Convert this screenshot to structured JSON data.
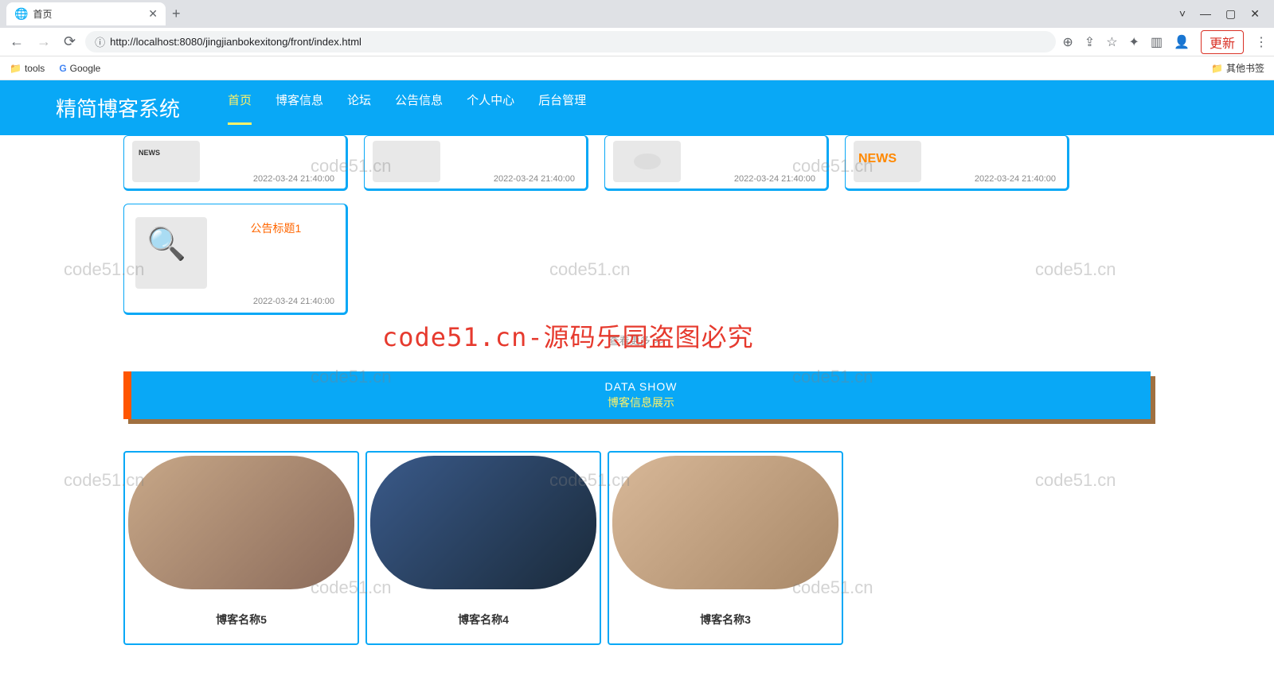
{
  "browser": {
    "tab_title": "首页",
    "new_tab": "+",
    "win": {
      "min": "—",
      "max": "▢",
      "close": "✕",
      "chevron": "˅"
    },
    "back": "←",
    "forward": "→",
    "reload": "⟳",
    "info_icon": "ⓘ",
    "url": "http://localhost:8080/jingjianbokexitong/front/index.html",
    "addr_icons": {
      "zoom": "⊕",
      "share": "⇪",
      "star": "☆",
      "ext": "✦",
      "panel": "▥",
      "profile": "👤",
      "menu": "⋮"
    },
    "update": "更新",
    "bookmarks": {
      "tools": "tools",
      "google": "Google",
      "other": "其他书签"
    }
  },
  "site": {
    "title": "精简博客系统",
    "nav": [
      "首页",
      "博客信息",
      "论坛",
      "公告信息",
      "个人中心",
      "后台管理"
    ]
  },
  "news_cards_row1": [
    {
      "date": "2022-03-24 21:40:00"
    },
    {
      "date": "2022-03-24 21:40:00"
    },
    {
      "date": "2022-03-24 21:40:00"
    },
    {
      "date": "2022-03-24 21:40:00"
    }
  ],
  "news_card2": {
    "title": "公告标题1",
    "date": "2022-03-24 21:40:00"
  },
  "more": "查看更多 >>",
  "section": {
    "en": "DATA SHOW",
    "cn": "博客信息展示"
  },
  "blogs": [
    {
      "name": "博客名称5"
    },
    {
      "name": "博客名称4"
    },
    {
      "name": "博客名称3"
    }
  ],
  "watermarks": {
    "wm": "code51.cn",
    "big": "code51.cn-源码乐园盗图必究"
  }
}
